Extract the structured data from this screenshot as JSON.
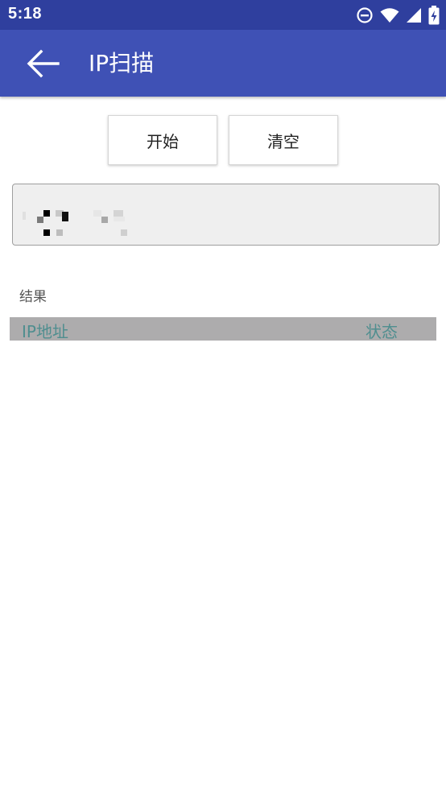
{
  "status_bar": {
    "time": "5:18",
    "icons": [
      "do-not-disturb-icon",
      "wifi-icon",
      "signal-icon",
      "battery-charging-icon"
    ]
  },
  "app_bar": {
    "title": "IP扫描",
    "back_icon": "arrow-left-icon"
  },
  "toolbar": {
    "start_label": "开始",
    "clear_label": "清空"
  },
  "ip_input": {
    "value": "",
    "placeholder": ""
  },
  "results": {
    "label": "结果",
    "columns": [
      "IP地址",
      "状态"
    ],
    "rows": []
  },
  "colors": {
    "status_bar": "#2f3f9e",
    "app_bar": "#3f51b5",
    "header_row_bg": "#adacad",
    "header_text": "#4f8e8f"
  }
}
